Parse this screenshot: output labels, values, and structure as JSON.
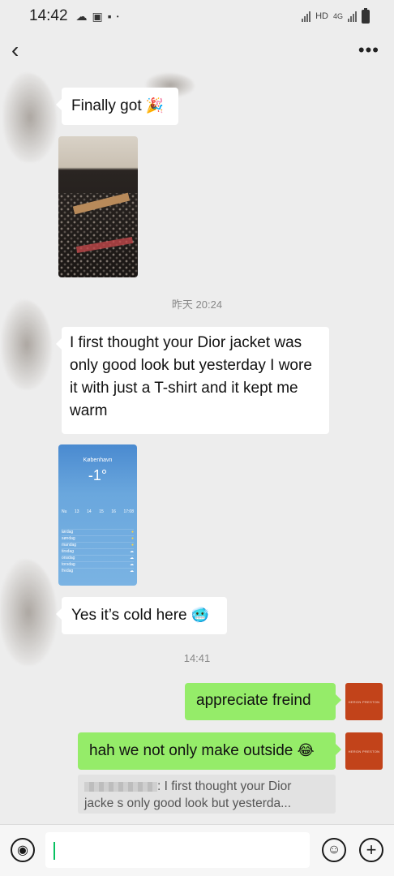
{
  "status_bar": {
    "time": "14:42",
    "net_label": "HD",
    "net_type": "4G"
  },
  "messages": {
    "m1_text": "Finally got",
    "m1_emoji": "🎉",
    "ts1": "昨天 20:24",
    "m2_lines": [
      "I first thought your Dior jacket was",
      "only good look but yesterday I wore",
      "it with just a T-shirt and it kept me",
      "warm"
    ],
    "weather": {
      "city": "København",
      "temp": "-1°",
      "hours": [
        "Nu",
        "13",
        "14",
        "15",
        "16",
        "17:08"
      ],
      "days": [
        "lørdag",
        "søndag",
        "mandag",
        "tirsdag",
        "onsdag",
        "torsdag",
        "fredag"
      ]
    },
    "m3_text": "Yes it’s cold here",
    "m3_emoji": "🥶",
    "ts2": "14:41",
    "m4_text": "appreciate  freind",
    "m5_text": "hah we  not only make outside",
    "m5_emoji": "😂",
    "quote_line1": ": I first thought your Dior",
    "quote_line2": "jacke    s only good look but yesterda...",
    "self_avatar_text": "HERON PRESTON"
  },
  "input": {
    "value": ""
  },
  "icons": {
    "back": "chevron-left",
    "more": "more-dots",
    "voice": "voice-icon",
    "emoji": "emoji-icon",
    "plus": "plus-icon"
  },
  "colors": {
    "self_bubble": "#95ec69",
    "other_bubble": "#ffffff",
    "background": "#ededed",
    "self_avatar": "#c2431a"
  }
}
